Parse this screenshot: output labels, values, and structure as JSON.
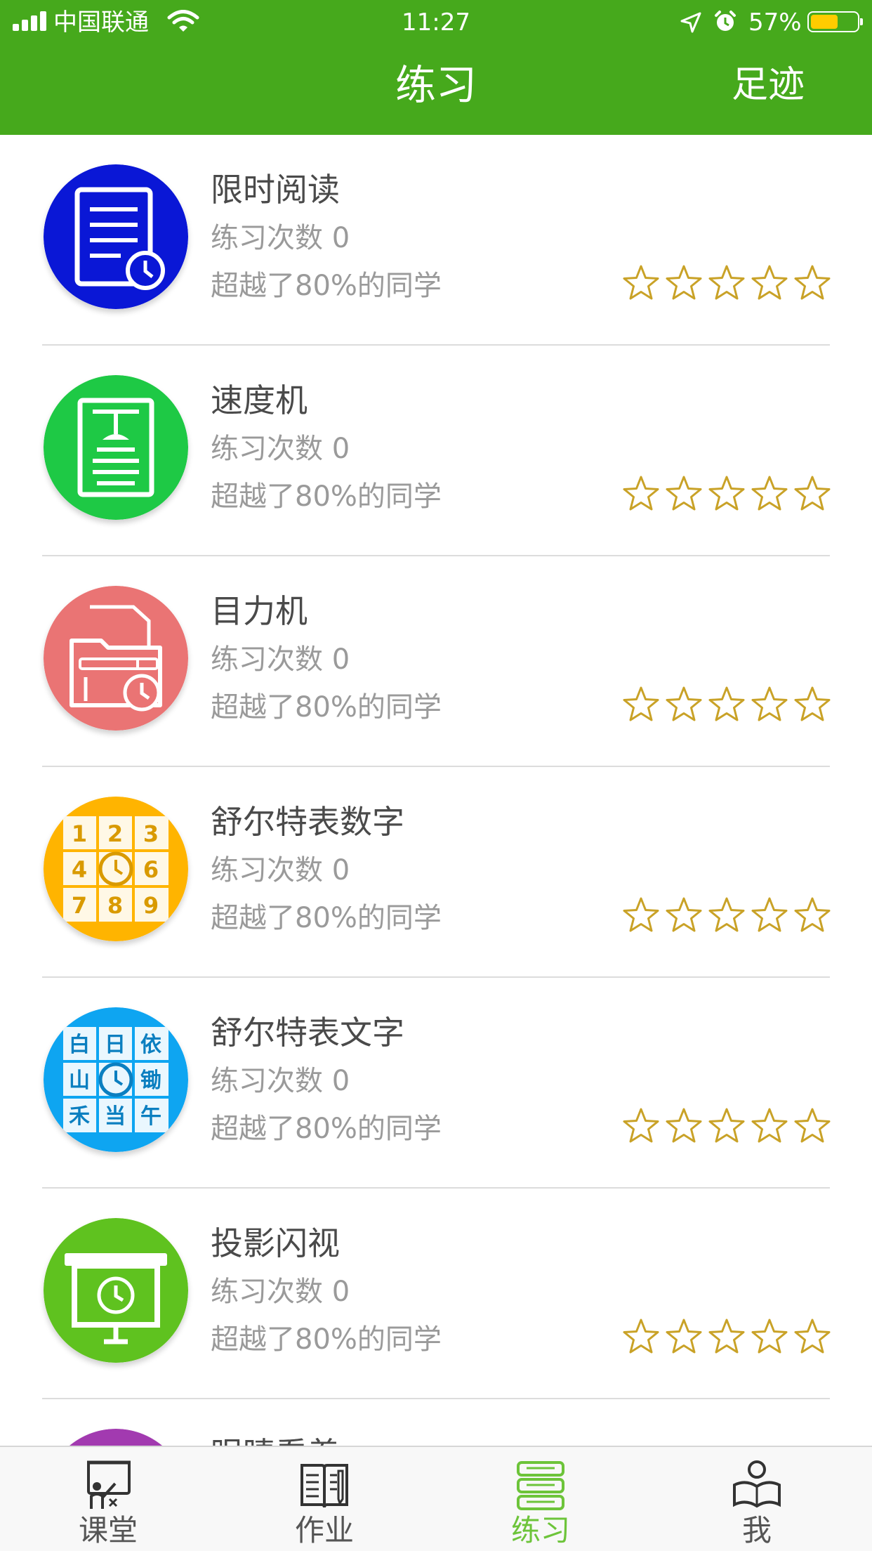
{
  "status_bar": {
    "carrier": "中国联通",
    "time": "11:27",
    "battery": "57%",
    "battery_level": 0.57,
    "battery_color": "#ffcc00"
  },
  "header": {
    "title": "练习",
    "right_action": "足迹",
    "background_color": "#46a91c"
  },
  "exercises": [
    {
      "name": "限时阅读",
      "count": "练习次数 0",
      "beat": "超越了80%的同学",
      "stars": 0,
      "max_stars": 5,
      "icon": "timed-reading-document-icon",
      "color": "#0a17d6"
    },
    {
      "name": "速度机",
      "count": "练习次数 0",
      "beat": "超越了80%的同学",
      "stars": 0,
      "max_stars": 5,
      "icon": "speed-machine-icon",
      "color": "#1ec945"
    },
    {
      "name": "目力机",
      "count": "练习次数 0",
      "beat": "超越了80%的同学",
      "stars": 0,
      "max_stars": 5,
      "icon": "eyesight-machine-folder-icon",
      "color": "#ea7474"
    },
    {
      "name": "舒尔特表数字",
      "count": "练习次数 0",
      "beat": "超越了80%的同学",
      "stars": 0,
      "max_stars": 5,
      "icon": "schulte-grid-numbers-icon",
      "color": "#ffb400",
      "grid_cells": [
        "1",
        "2",
        "3",
        "4",
        "6",
        "7",
        "8",
        "9"
      ]
    },
    {
      "name": "舒尔特表文字",
      "count": "练习次数 0",
      "beat": "超越了80%的同学",
      "stars": 0,
      "max_stars": 5,
      "icon": "schulte-grid-characters-icon",
      "color": "#0ea5f1",
      "grid_cells": [
        "白",
        "日",
        "依",
        "山",
        "锄",
        "禾",
        "当",
        "午"
      ]
    },
    {
      "name": "投影闪视",
      "count": "练习次数 0",
      "beat": "超越了80%的同学",
      "stars": 0,
      "max_stars": 5,
      "icon": "projection-screen-clock-icon",
      "color": "#5fc21f"
    },
    {
      "name": "眼睛看着",
      "count": "",
      "beat": "",
      "stars": 0,
      "max_stars": 5,
      "icon": "purple-exercise-icon",
      "color": "#a23ab0"
    }
  ],
  "tabbar": [
    {
      "label": "课堂",
      "icon": "classroom-teacher-board-icon",
      "active": false
    },
    {
      "label": "作业",
      "icon": "homework-book-pen-icon",
      "active": false
    },
    {
      "label": "练习",
      "icon": "practice-books-stack-icon",
      "active": true
    },
    {
      "label": "我",
      "icon": "profile-reading-person-icon",
      "active": false
    }
  ],
  "colors": {
    "active_tab": "#6dc43a",
    "star_gold": "#c9a227",
    "divider": "#dcdcdc"
  }
}
